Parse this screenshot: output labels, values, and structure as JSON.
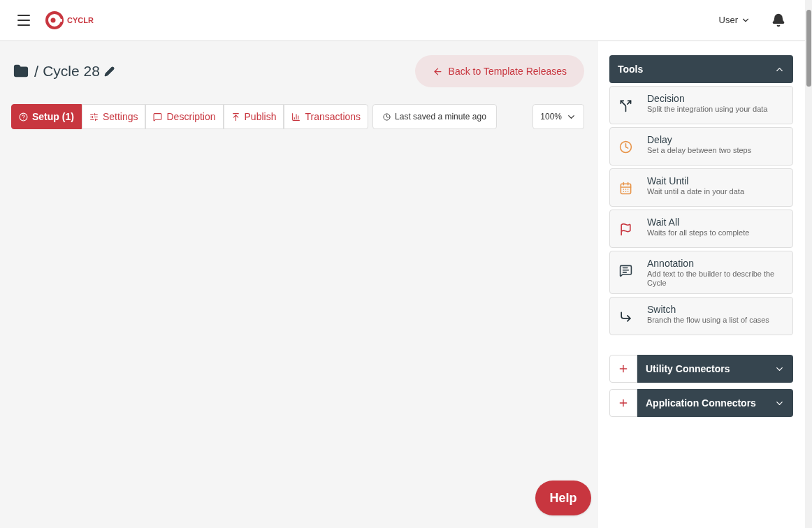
{
  "header": {
    "logo": "CYCLR",
    "user_menu": "User"
  },
  "title": {
    "separator": "/",
    "name": "Cycle 28"
  },
  "back_button": "Back to Template Releases",
  "tabs": [
    {
      "label": "Setup (1)",
      "kind": "setup",
      "selected": true
    },
    {
      "label": "Settings",
      "kind": "settings",
      "selected": false
    },
    {
      "label": "Description",
      "kind": "description",
      "selected": false
    },
    {
      "label": "Publish",
      "kind": "publish",
      "selected": false
    },
    {
      "label": "Transactions",
      "kind": "transactions",
      "selected": false
    }
  ],
  "save_status": "Last saved a minute ago",
  "zoom": "100%",
  "help_button": "Help",
  "tools_panel": {
    "title": "Tools",
    "expanded": true,
    "items": [
      {
        "kind": "decision",
        "name": "Decision",
        "description": "Split the integration using your data"
      },
      {
        "kind": "delay",
        "name": "Delay",
        "description": "Set a delay between two steps"
      },
      {
        "kind": "wait_until",
        "name": "Wait Until",
        "description": "Wait until a date in your data"
      },
      {
        "kind": "wait_all",
        "name": "Wait All",
        "description": "Waits for all steps to complete"
      },
      {
        "kind": "annotation",
        "name": "Annotation",
        "description": "Add text to the builder to describe the Cycle"
      },
      {
        "kind": "switch",
        "name": "Switch",
        "description": "Branch the flow using a list of cases"
      }
    ]
  },
  "connector_panels": [
    {
      "title": "Utility Connectors",
      "expanded": false
    },
    {
      "title": "Application Connectors",
      "expanded": false
    }
  ]
}
